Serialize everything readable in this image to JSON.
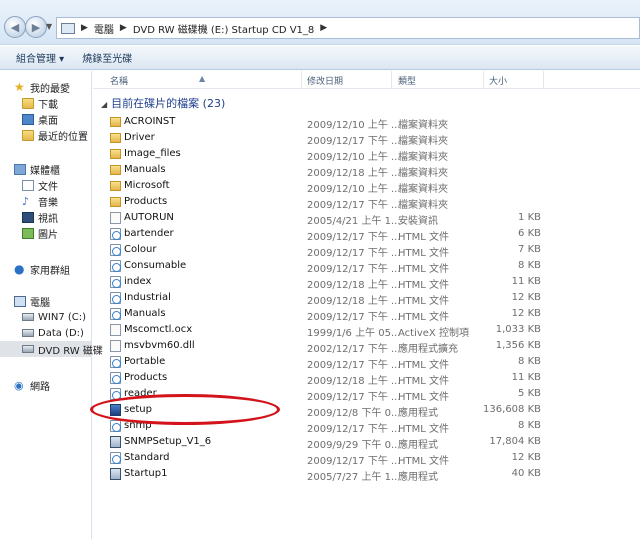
{
  "address": {
    "crumbs": [
      "電腦",
      "DVD RW 磁碟機 (E:) Startup CD V1_8"
    ]
  },
  "toolbar": {
    "organize": "組合管理 ▾",
    "burn": "燒錄至光碟"
  },
  "nav": {
    "favorites": "我的最愛",
    "downloads": "下載",
    "desktop": "桌面",
    "recent": "最近的位置",
    "libraries": "媒體櫃",
    "documents": "文件",
    "music": "音樂",
    "videos": "視訊",
    "pictures": "圖片",
    "homegroup": "家用群組",
    "computer": "電腦",
    "drive_c": "WIN7 (C:)",
    "drive_d": "Data (D:)",
    "drive_e": "DVD RW 磁碟",
    "network": "網路"
  },
  "columns": {
    "name": "名稱",
    "date": "修改日期",
    "type": "類型",
    "size": "大小"
  },
  "group_header": "目前在碟片的檔案 (23)",
  "files": [
    {
      "name": "ACROINST",
      "date": "2009/12/10 上午 ...",
      "type": "檔案資料夾",
      "size": "",
      "icon": "folder-icon"
    },
    {
      "name": "Driver",
      "date": "2009/12/17 下午 ...",
      "type": "檔案資料夾",
      "size": "",
      "icon": "folder-icon"
    },
    {
      "name": "Image_files",
      "date": "2009/12/10 上午 ...",
      "type": "檔案資料夾",
      "size": "",
      "icon": "folder-icon"
    },
    {
      "name": "Manuals",
      "date": "2009/12/18 上午 ...",
      "type": "檔案資料夾",
      "size": "",
      "icon": "folder-icon"
    },
    {
      "name": "Microsoft",
      "date": "2009/12/10 上午 ...",
      "type": "檔案資料夾",
      "size": "",
      "icon": "folder-icon"
    },
    {
      "name": "Products",
      "date": "2009/12/17 下午 ...",
      "type": "檔案資料夾",
      "size": "",
      "icon": "folder-icon"
    },
    {
      "name": "AUTORUN",
      "date": "2005/4/21 上午 1...",
      "type": "安裝資訊",
      "size": "1 KB",
      "icon": "settings-file-icon"
    },
    {
      "name": "bartender",
      "date": "2009/12/17 下午 ...",
      "type": "HTML 文件",
      "size": "6 KB",
      "icon": "html-file-icon"
    },
    {
      "name": "Colour",
      "date": "2009/12/17 下午 ...",
      "type": "HTML 文件",
      "size": "7 KB",
      "icon": "html-file-icon"
    },
    {
      "name": "Consumable",
      "date": "2009/12/17 下午 ...",
      "type": "HTML 文件",
      "size": "8 KB",
      "icon": "html-file-icon"
    },
    {
      "name": "index",
      "date": "2009/12/18 上午 ...",
      "type": "HTML 文件",
      "size": "11 KB",
      "icon": "html-file-icon"
    },
    {
      "name": "Industrial",
      "date": "2009/12/18 上午 ...",
      "type": "HTML 文件",
      "size": "12 KB",
      "icon": "html-file-icon"
    },
    {
      "name": "Manuals",
      "date": "2009/12/17 下午 ...",
      "type": "HTML 文件",
      "size": "12 KB",
      "icon": "html-file-icon"
    },
    {
      "name": "Mscomctl.ocx",
      "date": "1999/1/6 上午 05...",
      "type": "ActiveX 控制項",
      "size": "1,033 KB",
      "icon": "system-file-icon"
    },
    {
      "name": "msvbvm60.dll",
      "date": "2002/12/17 下午 ...",
      "type": "應用程式擴充",
      "size": "1,356 KB",
      "icon": "system-file-icon"
    },
    {
      "name": "Portable",
      "date": "2009/12/17 下午 ...",
      "type": "HTML 文件",
      "size": "8 KB",
      "icon": "html-file-icon"
    },
    {
      "name": "Products",
      "date": "2009/12/18 上午 ...",
      "type": "HTML 文件",
      "size": "11 KB",
      "icon": "html-file-icon"
    },
    {
      "name": "reader",
      "date": "2009/12/17 下午 ...",
      "type": "HTML 文件",
      "size": "5 KB",
      "icon": "html-file-icon"
    },
    {
      "name": "setup",
      "date": "2009/12/8 下午 0...",
      "type": "應用程式",
      "size": "136,608 KB",
      "icon": "setup-app-icon"
    },
    {
      "name": "snmp",
      "date": "2009/12/17 下午 ...",
      "type": "HTML 文件",
      "size": "8 KB",
      "icon": "html-file-icon"
    },
    {
      "name": "SNMPSetup_V1_6",
      "date": "2009/9/29 下午 0...",
      "type": "應用程式",
      "size": "17,804 KB",
      "icon": "app-icon"
    },
    {
      "name": "Standard",
      "date": "2009/12/17 下午 ...",
      "type": "HTML 文件",
      "size": "12 KB",
      "icon": "html-file-icon"
    },
    {
      "name": "Startup1",
      "date": "2005/7/27 上午 1...",
      "type": "應用程式",
      "size": "40 KB",
      "icon": "app-icon"
    }
  ],
  "highlight_color": "#d3121a"
}
